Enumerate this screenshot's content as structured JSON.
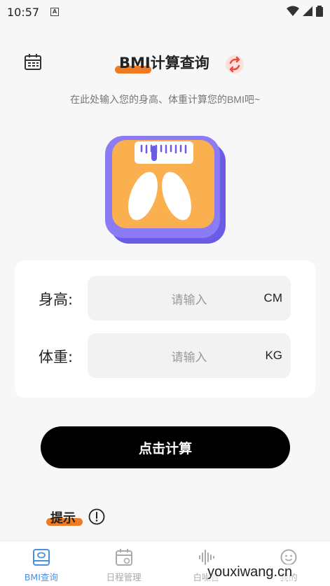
{
  "status": {
    "time": "10:57",
    "a_badge": "A"
  },
  "header": {
    "title": "BMI计算查询"
  },
  "subtitle": "在此处输入您的身高、体重计算您的BMI吧~",
  "form": {
    "height": {
      "label": "身高:",
      "placeholder": "请输入",
      "unit": "CM"
    },
    "weight": {
      "label": "体重:",
      "placeholder": "请输入",
      "unit": "KG"
    }
  },
  "calc_button": "点击计算",
  "tip": {
    "label": "提示"
  },
  "tabs": [
    {
      "label": "BMI查询",
      "icon": "bmi-icon",
      "active": true
    },
    {
      "label": "日程管理",
      "icon": "schedule-icon",
      "active": false
    },
    {
      "label": "白噪音",
      "icon": "sound-wave-icon",
      "active": false
    },
    {
      "label": "我的",
      "icon": "smile-face-icon",
      "active": false
    }
  ],
  "watermark": "youxiwang.cn",
  "colors": {
    "accent": "#f07a21",
    "active_tab": "#4a90e2",
    "button": "#000000"
  }
}
